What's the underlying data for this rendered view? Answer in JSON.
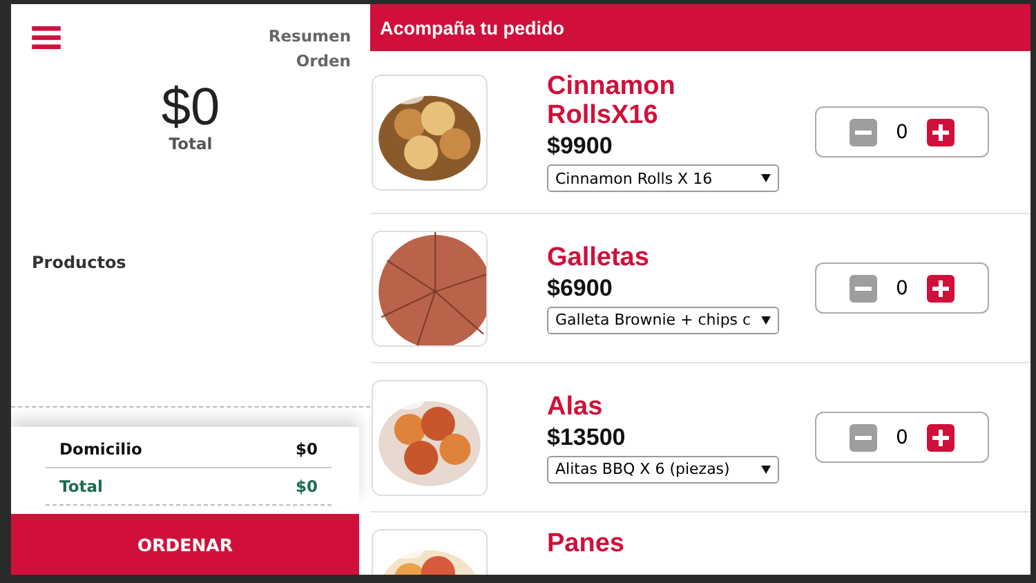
{
  "summary": {
    "title": "Resumen Orden",
    "amount": "$0",
    "amount_label": "Total",
    "products_label": "Productos",
    "lines": [
      {
        "label": "Domicilio",
        "value": "$0",
        "kind": "plain"
      },
      {
        "label": "Total",
        "value": "$0",
        "kind": "total"
      }
    ],
    "order_button": "ORDENAR"
  },
  "panel": {
    "title": "Acompaña tu pedido"
  },
  "products": [
    {
      "name": "Cinnamon RollsX16",
      "price": "$9900",
      "option": "Cinnamon Rolls X 16",
      "count": "0"
    },
    {
      "name": "Galletas",
      "price": "$6900",
      "option": "Galleta Brownie + chips c",
      "count": "0"
    },
    {
      "name": "Alas",
      "price": "$13500",
      "option": "Alitas BBQ X 6 (piezas)",
      "count": "0"
    },
    {
      "name": "Panes"
    }
  ]
}
